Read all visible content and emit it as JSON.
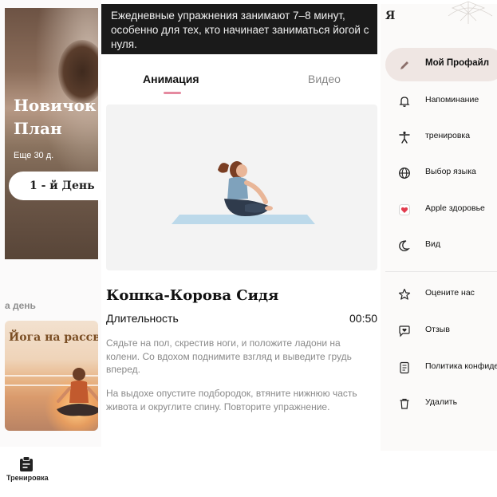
{
  "left_panel": {
    "hero_title": "Новичок\nПлан",
    "hero_subtitle": "Еще 30 д.",
    "hero_button": "1 - й День",
    "section_label": "а день",
    "card_title": "Йога на рассвете",
    "bottom_nav_label": "Тренировка",
    "bottom_nav_icon": "clipboard-icon"
  },
  "middle_panel": {
    "tooltip": "Ежедневные упражнения занимают 7–8 минут, особенно для тех, кто начинает заниматься йогой с нуля.",
    "tabs": [
      {
        "label": "Анимация",
        "active": true
      },
      {
        "label": "Видео",
        "active": false
      }
    ],
    "exercise_title": "Кошка-Корова Сидя",
    "duration_label": "Длительность",
    "duration_value": "00:50",
    "description_1": "Сядьте на пол, скрестив ноги, и положите ладони на колени. Со вдохом поднимите взгляд и выведите грудь вперед.",
    "description_2": "На выдохе опустите подбородок, втяните нижнюю часть живота и округлите спину. Повторите упражнение.",
    "accent_color": "#e58aa0"
  },
  "right_panel": {
    "header": "Я",
    "menu": [
      {
        "label": "Мой Профайл",
        "icon": "pencil-icon"
      },
      {
        "label": "Напоминание",
        "icon": "bell-icon"
      },
      {
        "label": "тренировка",
        "icon": "person-stretch-icon"
      },
      {
        "label": "Выбор языка",
        "icon": "globe-icon"
      },
      {
        "label": "Apple здоровье",
        "icon": "apple-health-icon"
      },
      {
        "label": "Вид",
        "icon": "moon-icon"
      },
      {
        "label": "Оцените нас",
        "icon": "star-icon"
      },
      {
        "label": "Отзыв",
        "icon": "chat-heart-icon"
      },
      {
        "label": "Политика конфиденциальности",
        "icon": "document-icon"
      },
      {
        "label": "Удалить",
        "icon": "trash-icon"
      }
    ],
    "profile_highlight_color": "#efe6e3"
  }
}
